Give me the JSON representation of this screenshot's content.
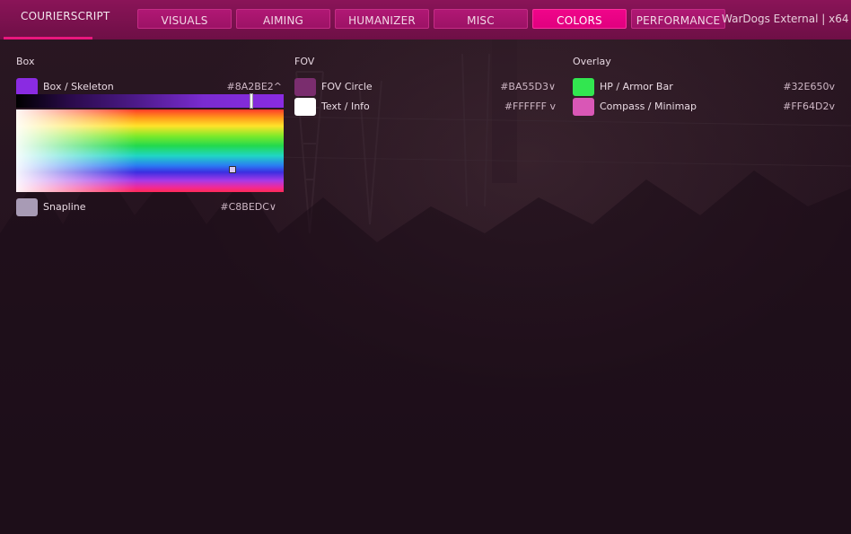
{
  "app": {
    "brand": "COURIERSCRIPT",
    "window_title": "WarDogs External | x64"
  },
  "tabs": [
    {
      "label": "VISUALS",
      "active": false
    },
    {
      "label": "AIMING",
      "active": false
    },
    {
      "label": "HUMANIZER",
      "active": false
    },
    {
      "label": "MISC",
      "active": false
    },
    {
      "label": "COLORS",
      "active": true
    },
    {
      "label": "PERFORMANCE",
      "active": false
    }
  ],
  "sections": {
    "box": {
      "title": "Box",
      "items": [
        {
          "label": "Box / Skeleton",
          "hex": "#8A2BE2^",
          "color": "#8a2be2",
          "expanded": true
        },
        {
          "label": "Snapline",
          "hex": "#C8BEDC∨",
          "color": "#a89bb5",
          "expanded": false
        }
      ],
      "picker": {
        "hue_level": 0.88,
        "spectrum_point": {
          "saturation": 0.81,
          "value": 0.73
        }
      }
    },
    "fov": {
      "title": "FOV",
      "items": [
        {
          "label": "FOV Circle",
          "hex": "#BA55D3∨",
          "color": "#7a2d6e"
        },
        {
          "label": "Text / Info",
          "hex": "#FFFFFF v",
          "color": "#ffffff"
        }
      ]
    },
    "overlay": {
      "title": "Overlay",
      "items": [
        {
          "label": "HP / Armor Bar",
          "hex": "#32E650v",
          "color": "#32e650"
        },
        {
          "label": "Compass / Minimap",
          "hex": "#FF64D2v",
          "color": "#d957b6"
        }
      ]
    }
  },
  "colors": {
    "header": "#7a1250",
    "tab": "#a0146a",
    "tab_active": "#e8007f",
    "accent": "#e8177d"
  }
}
